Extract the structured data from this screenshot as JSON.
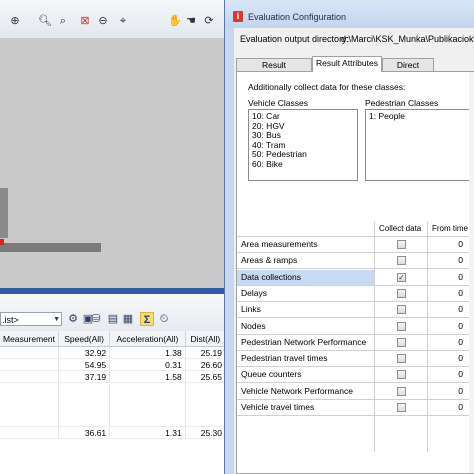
{
  "background_app": {
    "toolbar_icons": [
      "zoom-in-icon",
      "zoom-glass-icon",
      "zoom-fit-icon",
      "zoom-out-icon",
      "pan-hand-icon",
      "pan-hand2-icon",
      "rotate-icon",
      "plane-icon"
    ],
    "list_toolbar": {
      "selector_value": ".ist>",
      "icons": [
        "list-layout-icon",
        "database-icon",
        "save-icon",
        "export-icon",
        "sigma-icon",
        "time-icon"
      ]
    },
    "list_table": {
      "headers": [
        "Measurement",
        "Speed(All)",
        "Acceleration(All)",
        "Dist(All)"
      ],
      "rows": [
        [
          "",
          "32.92",
          "1.38",
          "25.19"
        ],
        [
          "",
          "54.95",
          "0.31",
          "26.60"
        ],
        [
          "",
          "37.19",
          "1.58",
          "25.65"
        ],
        [
          "",
          "36.61",
          "1.31",
          "25.30"
        ]
      ]
    }
  },
  "dialog": {
    "title": "Evaluation Configuration",
    "output_directory_label": "Evaluation output directory:",
    "output_directory_value": "d:\\Marci\\KSK_Munka\\Publikaciok\\",
    "tabs": [
      {
        "label": "Result Management",
        "active": false
      },
      {
        "label": "Result Attributes",
        "active": true
      },
      {
        "label": "Direct Output",
        "active": false
      }
    ],
    "additional_label": "Additionally collect data for these classes:",
    "vehicle_classes_label": "Vehicle Classes",
    "vehicle_classes": [
      "10: Car",
      "20: HGV",
      "30: Bus",
      "40: Tram",
      "50: Pedestrian",
      "60: Bike"
    ],
    "pedestrian_classes_label": "Pedestrian Classes",
    "pedestrian_classes": [
      "1: People"
    ],
    "grid": {
      "col_collect": "Collect data",
      "col_from": "From time",
      "col_to": "T",
      "rows": [
        {
          "name": "Area measurements",
          "checked": false,
          "from": "0",
          "selected": false
        },
        {
          "name": "Areas & ramps",
          "checked": false,
          "from": "0",
          "selected": false
        },
        {
          "name": "Data collections",
          "checked": true,
          "from": "0",
          "selected": true
        },
        {
          "name": "Delays",
          "checked": false,
          "from": "0",
          "selected": false
        },
        {
          "name": "Links",
          "checked": false,
          "from": "0",
          "selected": false
        },
        {
          "name": "Nodes",
          "checked": false,
          "from": "0",
          "selected": false
        },
        {
          "name": "Pedestrian Network Performance",
          "checked": false,
          "from": "0",
          "selected": false
        },
        {
          "name": "Pedestrian travel times",
          "checked": false,
          "from": "0",
          "selected": false
        },
        {
          "name": "Queue counters",
          "checked": false,
          "from": "0",
          "selected": false
        },
        {
          "name": "Vehicle Network Performance",
          "checked": false,
          "from": "0",
          "selected": false
        },
        {
          "name": "Vehicle travel times",
          "checked": false,
          "from": "0",
          "selected": false
        }
      ]
    }
  }
}
